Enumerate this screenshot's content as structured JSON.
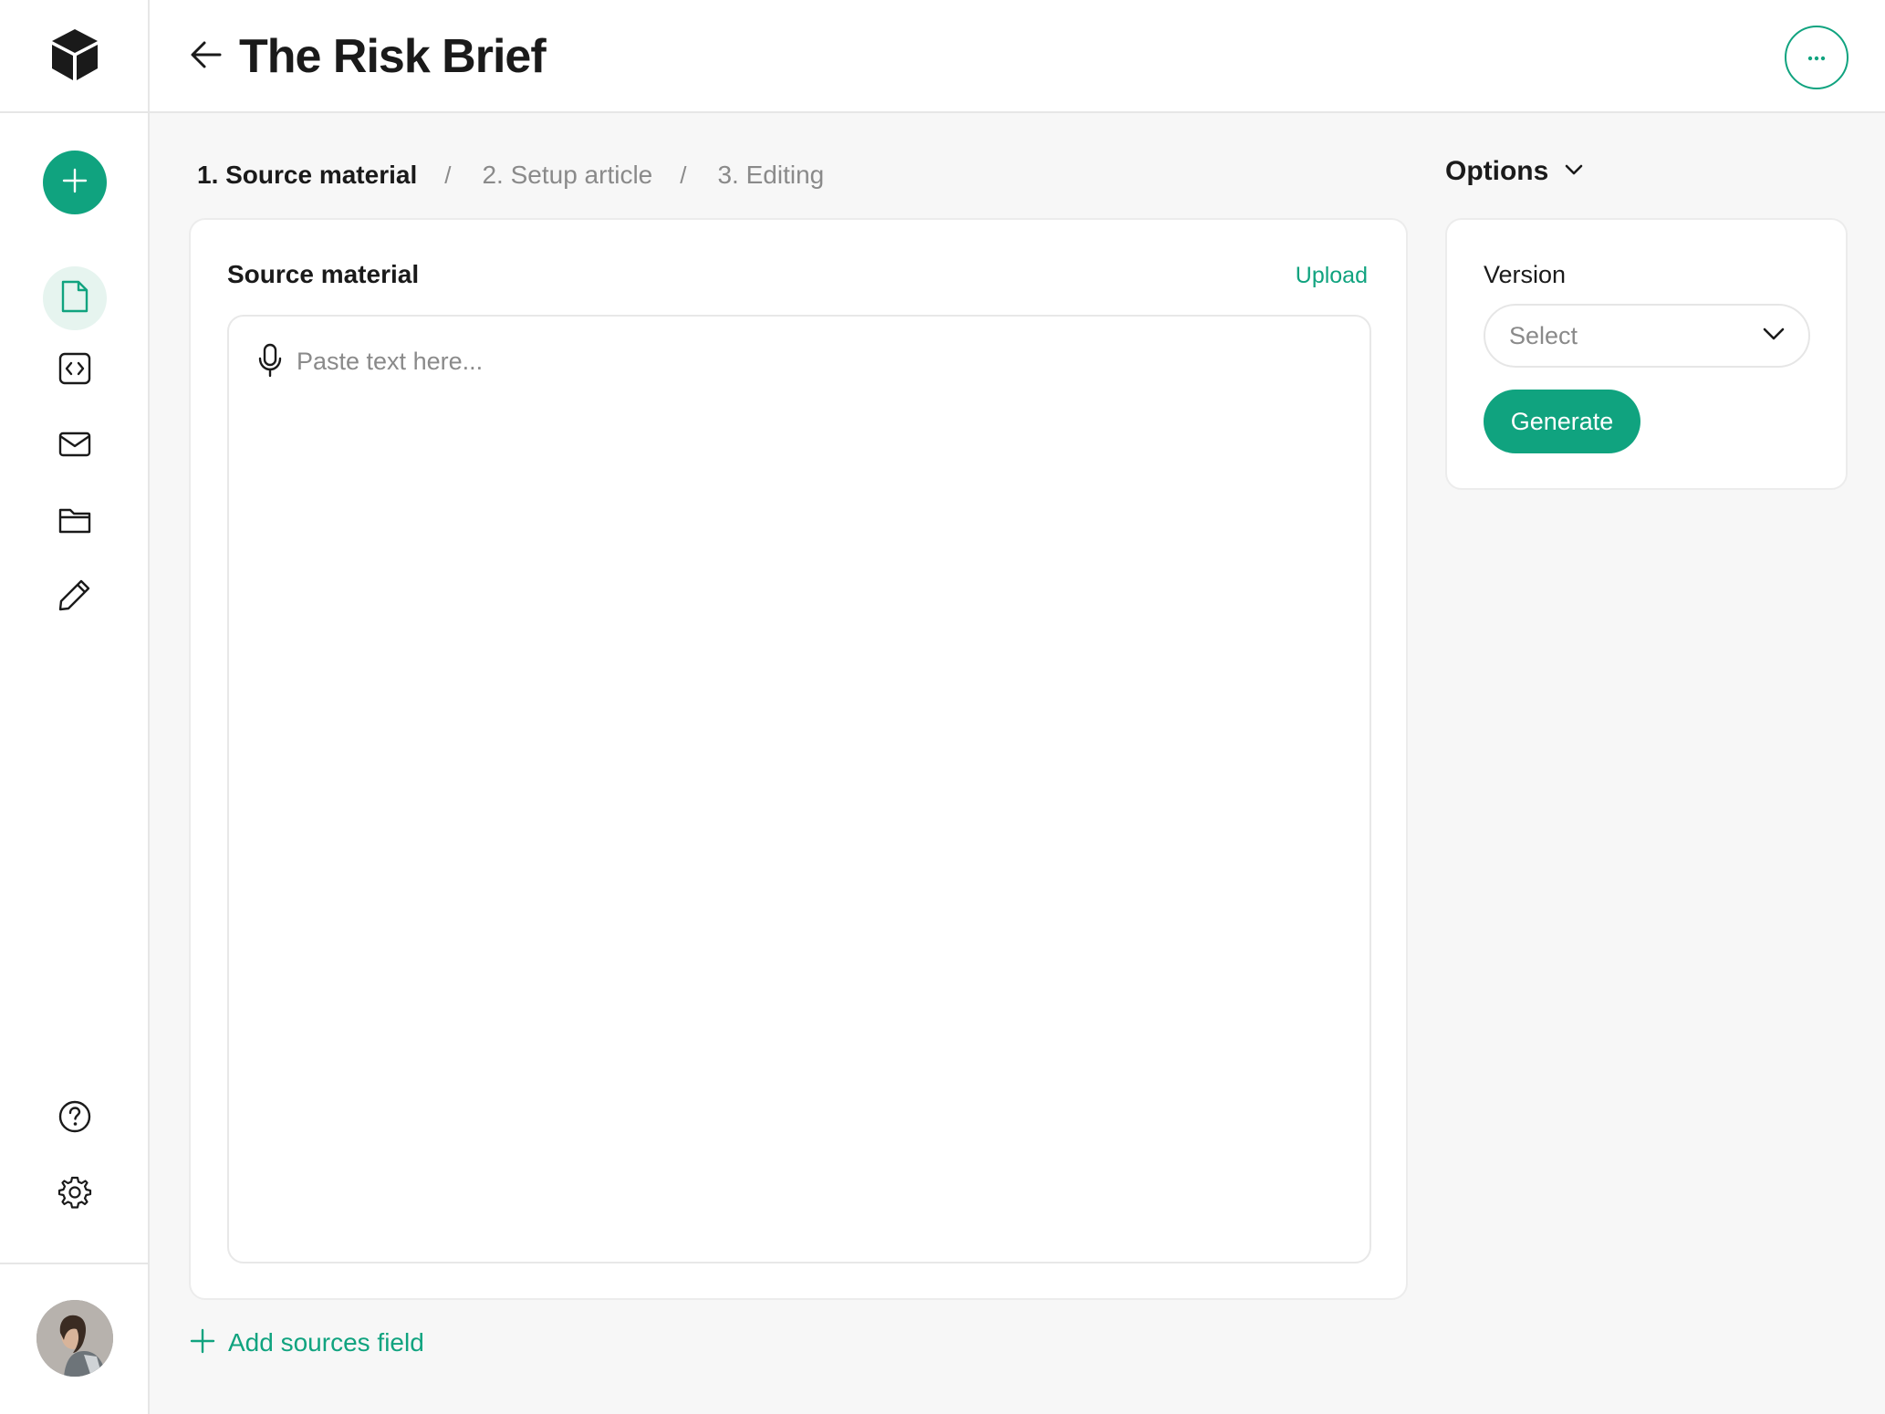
{
  "app": {
    "logo_icon": "cube-logo-icon"
  },
  "sidebar": {
    "new_button_icon": "plus-icon",
    "items": [
      {
        "name": "documents",
        "icon": "document-icon",
        "active": true
      },
      {
        "name": "code",
        "icon": "code-icon",
        "active": false
      },
      {
        "name": "mail",
        "icon": "mail-icon",
        "active": false
      },
      {
        "name": "folders",
        "icon": "folder-icon",
        "active": false
      },
      {
        "name": "edit",
        "icon": "pencil-icon",
        "active": false
      }
    ],
    "bottom_items": [
      {
        "name": "help",
        "icon": "help-icon"
      },
      {
        "name": "settings",
        "icon": "gear-icon"
      }
    ],
    "avatar_icon": "user-avatar"
  },
  "header": {
    "title": "The Risk Brief",
    "back_icon": "arrow-left-icon",
    "more_icon": "ellipsis-icon"
  },
  "steps": [
    {
      "label": "1. Source material",
      "current": true
    },
    {
      "label": "2. Setup article",
      "current": false
    },
    {
      "label": "3. Editing",
      "current": false
    }
  ],
  "step_separator": "/",
  "source": {
    "title": "Source material",
    "upload_label": "Upload",
    "placeholder": "Paste text here...",
    "value": ""
  },
  "add_sources_label": "Add sources field",
  "options": {
    "label": "Options",
    "version_label": "Version",
    "select_value": "Select",
    "generate_label": "Generate"
  },
  "colors": {
    "accent": "#10a37f",
    "accent_light": "#e6f4ef",
    "background": "#f7f7f7",
    "text": "#1a1a1a",
    "muted": "#8a8a8a"
  }
}
